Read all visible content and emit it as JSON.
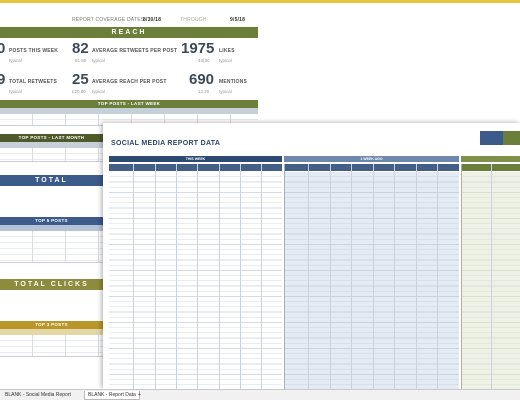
{
  "colors": {
    "accent_green": "#6b7f3a",
    "accent_blue": "#3c5a8a",
    "accent_gold": "#b8962a",
    "top_stripe": "#e6c63c"
  },
  "report": {
    "coverage_label": "REPORT COVERAGE DATES",
    "start_date": "8/30/18",
    "through_label": "THROUGH",
    "end_date": "9/5/18",
    "reach_header": "REACH",
    "metrics": [
      {
        "value": "0",
        "label": "POSTS THIS WEEK",
        "typical_label": "typical",
        "typical_value": ""
      },
      {
        "value": "82",
        "label": "AVERAGE RETWEETS PER POST",
        "typical_label": "typical",
        "typical_value": "81.90"
      },
      {
        "value": "1975",
        "label": "LIKES",
        "typical_label": "typical",
        "typical_value": "44(30"
      },
      {
        "value": "9",
        "label": "TOTAL RETWEETS",
        "typical_label": "typical",
        "typical_value": ""
      },
      {
        "value": "25",
        "label": "AVERAGE REACH PER POST",
        "typical_label": "typical",
        "typical_value": "£20.80"
      },
      {
        "value": "690",
        "label": "MENTIONS",
        "typical_label": "typical",
        "typical_value": "12.20"
      }
    ],
    "top_posts_last_week": "TOP POSTS - LAST WEEK",
    "top_posts_last_month": "TOP POSTS - LAST MONTH",
    "total_engagement": "TOTAL ENGAGEMENT",
    "top5_posts": "TOP 5 POSTS",
    "total_clicks": "TOTAL CLICKS",
    "top3_posts": "TOP 3 POSTS"
  },
  "data_sheet": {
    "title": "SOCIAL MEDIA REPORT DATA",
    "group_this_week": "THIS WEEK",
    "group_week_ago": "1 WEEK AGO"
  },
  "tabs": [
    {
      "label": "BLANK - Social Media Report"
    },
    {
      "label": "BLANK - Report Data"
    },
    {
      "label": "+"
    }
  ]
}
